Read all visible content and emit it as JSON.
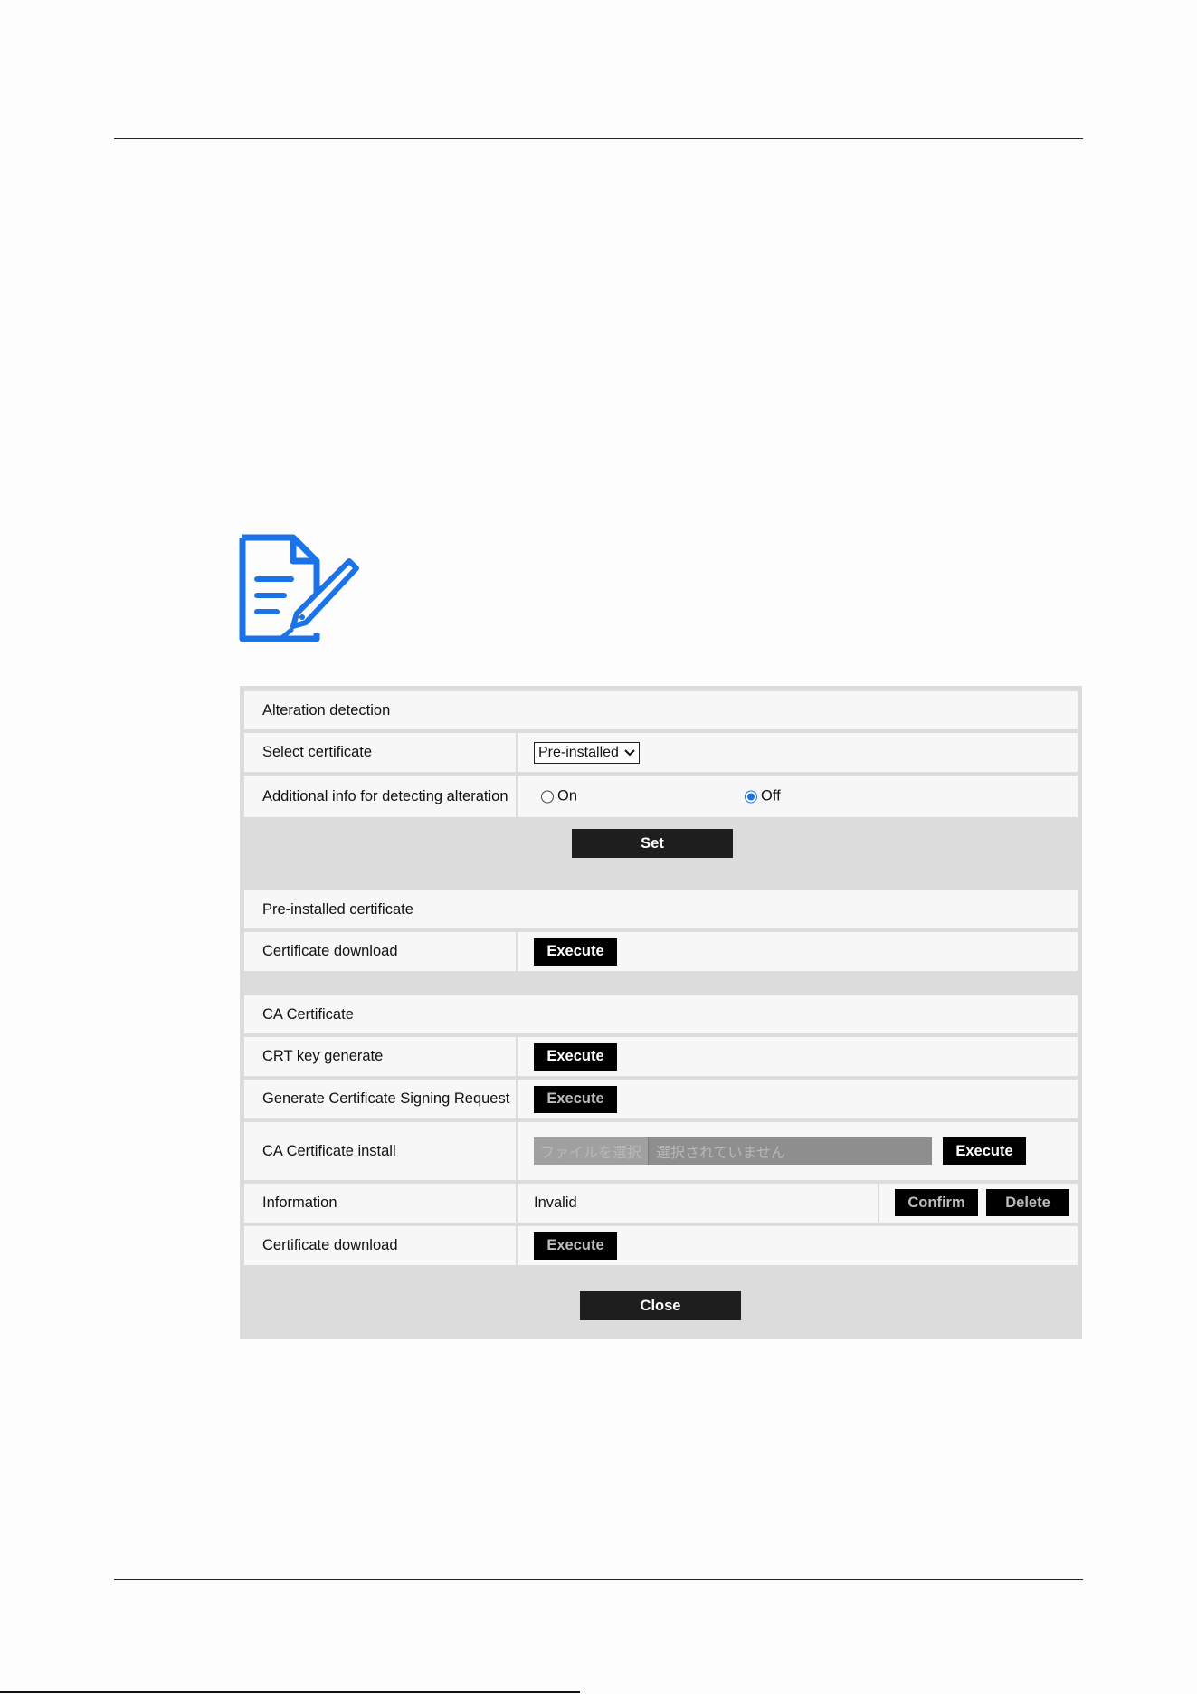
{
  "settings": {
    "alteration_header": "Alteration detection",
    "select_certificate": {
      "label": "Select certificate",
      "value": "Pre-installed"
    },
    "additional_info": {
      "label": "Additional info for detecting alteration",
      "option_on": "On",
      "option_off": "Off",
      "selected": "Off"
    },
    "set_label": "Set",
    "preinstalled_header": "Pre-installed certificate",
    "preinstalled_download": {
      "label": "Certificate download",
      "button": "Execute"
    },
    "ca_header": "CA Certificate",
    "crt_key": {
      "label": "CRT key generate",
      "button": "Execute"
    },
    "csr": {
      "label": "Generate Certificate Signing Request",
      "button": "Execute"
    },
    "ca_install": {
      "label": "CA Certificate install",
      "choose_file": "ファイルを選択",
      "no_file": "選択されていません",
      "button": "Execute"
    },
    "information": {
      "label": "Information",
      "value": "Invalid",
      "confirm": "Confirm",
      "delete": "Delete"
    },
    "ca_download": {
      "label": "Certificate download",
      "button": "Execute"
    },
    "close_label": "Close"
  },
  "icons": {
    "note": "note-pen-icon",
    "chevron": "chevron-down-icon"
  },
  "colors": {
    "accent": "#1a73e8",
    "button": "#000000",
    "panel": "#dcdcdc"
  }
}
